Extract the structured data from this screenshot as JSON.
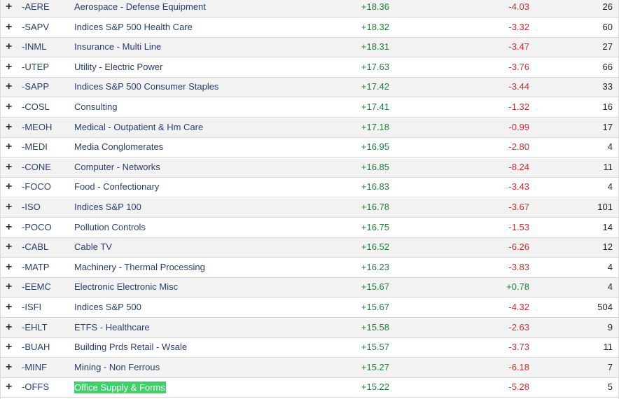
{
  "rows": [
    {
      "symbol": "-AERE",
      "name": "Aerospace - Defense Equipment",
      "pct": "+18.36",
      "chg": "-4.03",
      "count": "26"
    },
    {
      "symbol": "-SAPV",
      "name": "Indices S&P 500 Health Care",
      "pct": "+18.32",
      "chg": "-3.32",
      "count": "60"
    },
    {
      "symbol": "-INML",
      "name": "Insurance - Multi Line",
      "pct": "+18.31",
      "chg": "-3.47",
      "count": "27"
    },
    {
      "symbol": "-UTEP",
      "name": "Utility - Electric Power",
      "pct": "+17.63",
      "chg": "-3.76",
      "count": "66"
    },
    {
      "symbol": "-SAPP",
      "name": "Indices S&P 500 Consumer Staples",
      "pct": "+17.42",
      "chg": "-3.44",
      "count": "33"
    },
    {
      "symbol": "-COSL",
      "name": "Consulting",
      "pct": "+17.41",
      "chg": "-1.32",
      "count": "16"
    },
    {
      "symbol": "-MEOH",
      "name": "Medical - Outpatient & Hm Care",
      "pct": "+17.18",
      "chg": "-0.99",
      "count": "17"
    },
    {
      "symbol": "-MEDI",
      "name": "Media Conglomerates",
      "pct": "+16.95",
      "chg": "-2.80",
      "count": "4"
    },
    {
      "symbol": "-CONE",
      "name": "Computer - Networks",
      "pct": "+16.85",
      "chg": "-8.24",
      "count": "11"
    },
    {
      "symbol": "-FOCO",
      "name": "Food - Confectionary",
      "pct": "+16.83",
      "chg": "-3.43",
      "count": "4"
    },
    {
      "symbol": "-ISO",
      "name": "Indices S&P 100",
      "pct": "+16.78",
      "chg": "-3.67",
      "count": "101"
    },
    {
      "symbol": "-POCO",
      "name": "Pollution Controls",
      "pct": "+16.75",
      "chg": "-1.53",
      "count": "14"
    },
    {
      "symbol": "-CABL",
      "name": "Cable TV",
      "pct": "+16.52",
      "chg": "-6.26",
      "count": "12"
    },
    {
      "symbol": "-MATP",
      "name": "Machinery - Thermal Processing",
      "pct": "+16.23",
      "chg": "-3.83",
      "count": "4"
    },
    {
      "symbol": "-EEMC",
      "name": "Electronic Electronic Misc",
      "pct": "+15.67",
      "chg": "+0.78",
      "count": "4"
    },
    {
      "symbol": "-ISFI",
      "name": "Indices S&P 500",
      "pct": "+15.67",
      "chg": "-4.32",
      "count": "504"
    },
    {
      "symbol": "-EHLT",
      "name": "ETFS - Healthcare",
      "pct": "+15.58",
      "chg": "-2.63",
      "count": "9"
    },
    {
      "symbol": "-BUAH",
      "name": "Building Prds Retail - Wsale",
      "pct": "+15.57",
      "chg": "-3.73",
      "count": "11"
    },
    {
      "symbol": "-MINF",
      "name": "Mining - Non Ferrous",
      "pct": "+15.27",
      "chg": "-6.18",
      "count": "7"
    },
    {
      "symbol": "-OFFS",
      "name": "Office Supply & Forms",
      "pct": "+15.22",
      "chg": "-5.28",
      "count": "5",
      "highlighted": true
    }
  ],
  "expand_glyph": "+",
  "colors": {
    "symbol_name_text": "#2a3e6e",
    "positive": "#1e7f3a",
    "negative": "#c9302c",
    "highlight": "#3fcf6b",
    "row_alt": "#f2f2f2"
  },
  "icons": {
    "expand": "plus-icon"
  }
}
